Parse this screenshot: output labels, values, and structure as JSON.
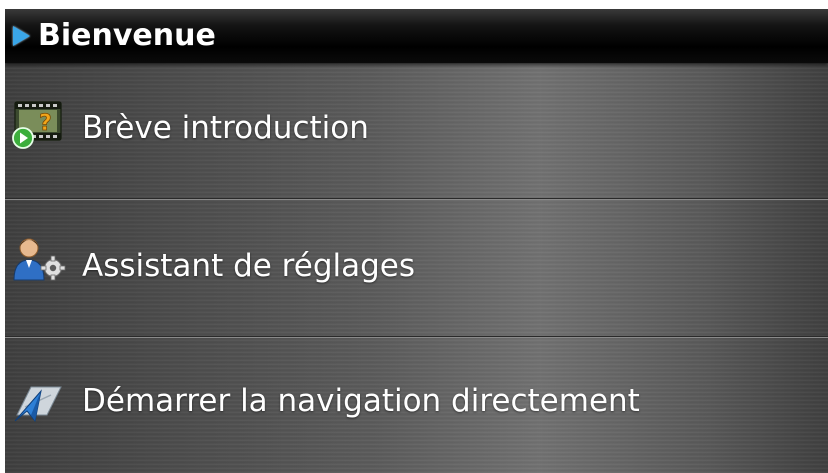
{
  "header": {
    "title": "Bienvenue",
    "icon": "play-triangle-icon",
    "accent_color": "#3aa6e8"
  },
  "menu": {
    "items": [
      {
        "label": "Brève introduction",
        "icon": "video-help-icon"
      },
      {
        "label": "Assistant de réglages",
        "icon": "user-settings-icon"
      },
      {
        "label": "Démarrer la navigation directement",
        "icon": "navigation-arrow-icon"
      }
    ]
  }
}
